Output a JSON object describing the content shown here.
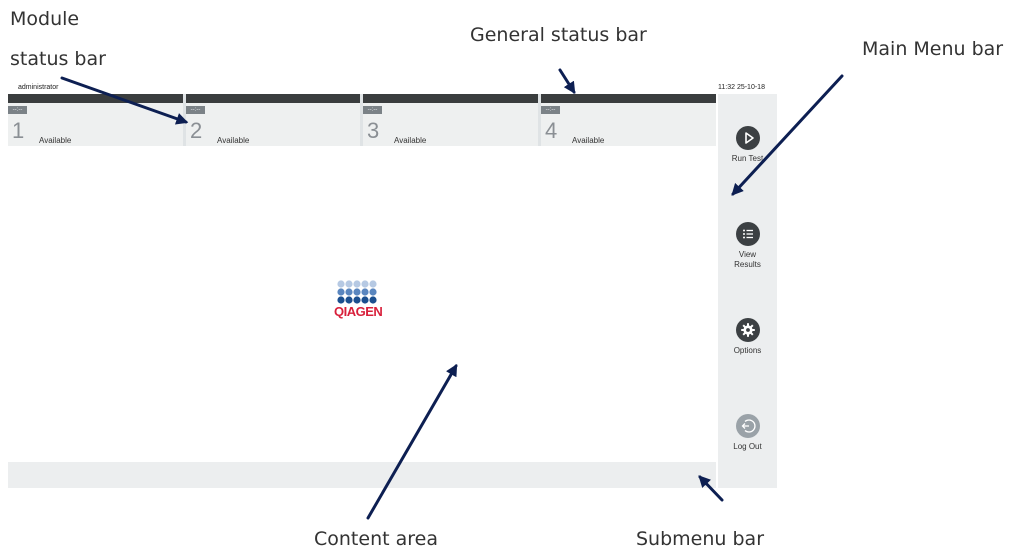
{
  "callouts": {
    "module_status_line1": "Module",
    "module_status_line2": "status bar",
    "general_status": "General status bar",
    "main_menu": "Main Menu bar",
    "content_area": "Content area",
    "submenu": "Submenu bar"
  },
  "status_bar": {
    "user": "administrator",
    "time": "11:32 25-10-18"
  },
  "modules": [
    {
      "tag": "--:--",
      "number": "1",
      "status": "Available"
    },
    {
      "tag": "--:--",
      "number": "2",
      "status": "Available"
    },
    {
      "tag": "--:--",
      "number": "3",
      "status": "Available"
    },
    {
      "tag": "--:--",
      "number": "4",
      "status": "Available"
    }
  ],
  "main_menu": {
    "run_test": "Run Test",
    "view_results_line1": "View",
    "view_results_line2": "Results",
    "options": "Options",
    "log_out": "Log Out"
  },
  "logo_text": "QIAGEN",
  "colors": {
    "arrow": "#0d1f52",
    "module_bar": "#3a3d3e",
    "menu_icon": "#3c4043",
    "logo_red": "#d8203b",
    "logo_blue_dark": "#1b4f8f",
    "logo_blue_mid": "#5a86bf",
    "logo_blue_light": "#b6c9e3"
  }
}
